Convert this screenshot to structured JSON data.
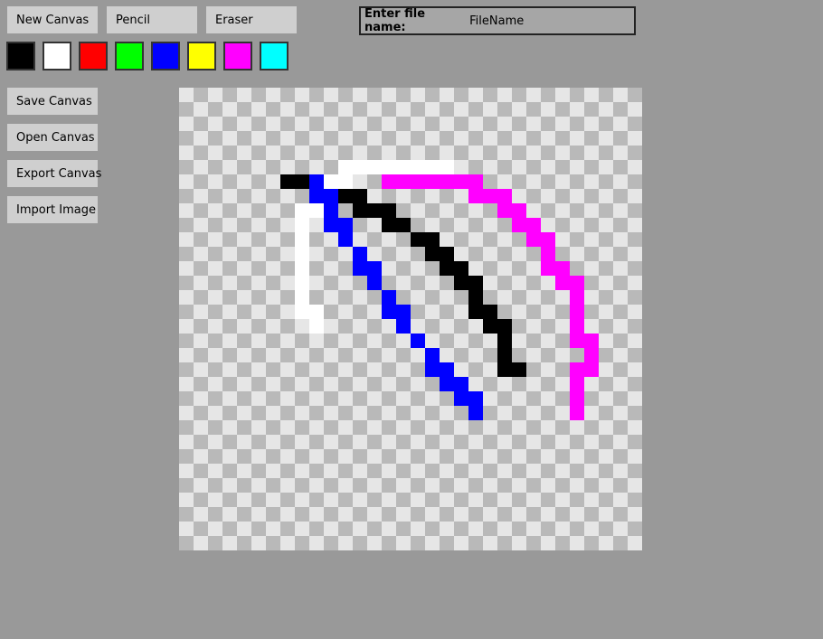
{
  "toolbar": {
    "new_canvas": "New Canvas",
    "pencil": "Pencil",
    "eraser": "Eraser"
  },
  "file_name": {
    "label": "Enter file name:",
    "value": "FileName"
  },
  "palette": [
    {
      "name": "black",
      "color": "#000000"
    },
    {
      "name": "white",
      "color": "#ffffff"
    },
    {
      "name": "red",
      "color": "#ff0000"
    },
    {
      "name": "green",
      "color": "#00ff00"
    },
    {
      "name": "blue",
      "color": "#0000ff"
    },
    {
      "name": "yellow",
      "color": "#ffff00"
    },
    {
      "name": "magenta",
      "color": "#ff00ff"
    },
    {
      "name": "cyan",
      "color": "#00ffff"
    }
  ],
  "sidebar": {
    "save_canvas": "Save Canvas",
    "open_canvas": "Open Canvas",
    "export_canvas": "Export Canvas",
    "import_image": "Import Image"
  },
  "canvas": {
    "grid_cells": 32,
    "checker_light": "#e6e6e6",
    "checker_dark": "#b9b9b9",
    "strokes": [
      {
        "color": "#ffffff",
        "cells": [
          [
            11,
            5
          ],
          [
            12,
            5
          ],
          [
            13,
            5
          ],
          [
            14,
            5
          ],
          [
            15,
            5
          ],
          [
            16,
            5
          ],
          [
            17,
            5
          ],
          [
            18,
            5
          ],
          [
            10,
            6
          ],
          [
            11,
            6
          ],
          [
            8,
            8
          ],
          [
            9,
            8
          ],
          [
            8,
            9
          ],
          [
            8,
            10
          ],
          [
            8,
            11
          ],
          [
            8,
            12
          ],
          [
            8,
            13
          ],
          [
            8,
            14
          ],
          [
            8,
            15
          ],
          [
            9,
            15
          ],
          [
            9,
            16
          ]
        ]
      },
      {
        "color": "#000000",
        "cells": [
          [
            7,
            6
          ],
          [
            8,
            6
          ],
          [
            11,
            7
          ],
          [
            12,
            7
          ],
          [
            12,
            8
          ],
          [
            13,
            8
          ],
          [
            14,
            8
          ],
          [
            14,
            9
          ],
          [
            15,
            9
          ],
          [
            16,
            10
          ],
          [
            17,
            10
          ],
          [
            17,
            11
          ],
          [
            18,
            11
          ],
          [
            18,
            12
          ],
          [
            19,
            12
          ],
          [
            19,
            13
          ],
          [
            20,
            13
          ],
          [
            20,
            14
          ],
          [
            20,
            15
          ],
          [
            21,
            15
          ],
          [
            21,
            16
          ],
          [
            22,
            16
          ],
          [
            22,
            17
          ],
          [
            22,
            18
          ],
          [
            22,
            19
          ],
          [
            23,
            19
          ]
        ]
      },
      {
        "color": "#0000ff",
        "cells": [
          [
            9,
            6
          ],
          [
            9,
            7
          ],
          [
            10,
            7
          ],
          [
            10,
            8
          ],
          [
            10,
            9
          ],
          [
            11,
            9
          ],
          [
            11,
            10
          ],
          [
            12,
            11
          ],
          [
            12,
            12
          ],
          [
            13,
            12
          ],
          [
            13,
            13
          ],
          [
            14,
            14
          ],
          [
            14,
            15
          ],
          [
            15,
            15
          ],
          [
            15,
            16
          ],
          [
            16,
            17
          ],
          [
            17,
            18
          ],
          [
            17,
            19
          ],
          [
            18,
            19
          ],
          [
            18,
            20
          ],
          [
            19,
            20
          ],
          [
            19,
            21
          ],
          [
            20,
            21
          ],
          [
            20,
            22
          ]
        ]
      },
      {
        "color": "#ff00ff",
        "cells": [
          [
            14,
            6
          ],
          [
            15,
            6
          ],
          [
            16,
            6
          ],
          [
            17,
            6
          ],
          [
            18,
            6
          ],
          [
            19,
            6
          ],
          [
            20,
            6
          ],
          [
            20,
            7
          ],
          [
            21,
            7
          ],
          [
            22,
            7
          ],
          [
            22,
            8
          ],
          [
            23,
            8
          ],
          [
            23,
            9
          ],
          [
            24,
            9
          ],
          [
            24,
            10
          ],
          [
            25,
            10
          ],
          [
            25,
            11
          ],
          [
            25,
            12
          ],
          [
            26,
            12
          ],
          [
            26,
            13
          ],
          [
            27,
            13
          ],
          [
            27,
            14
          ],
          [
            27,
            15
          ],
          [
            27,
            16
          ],
          [
            27,
            17
          ],
          [
            28,
            17
          ],
          [
            28,
            18
          ],
          [
            27,
            19
          ],
          [
            28,
            19
          ],
          [
            27,
            20
          ],
          [
            27,
            21
          ],
          [
            27,
            22
          ]
        ]
      }
    ]
  }
}
